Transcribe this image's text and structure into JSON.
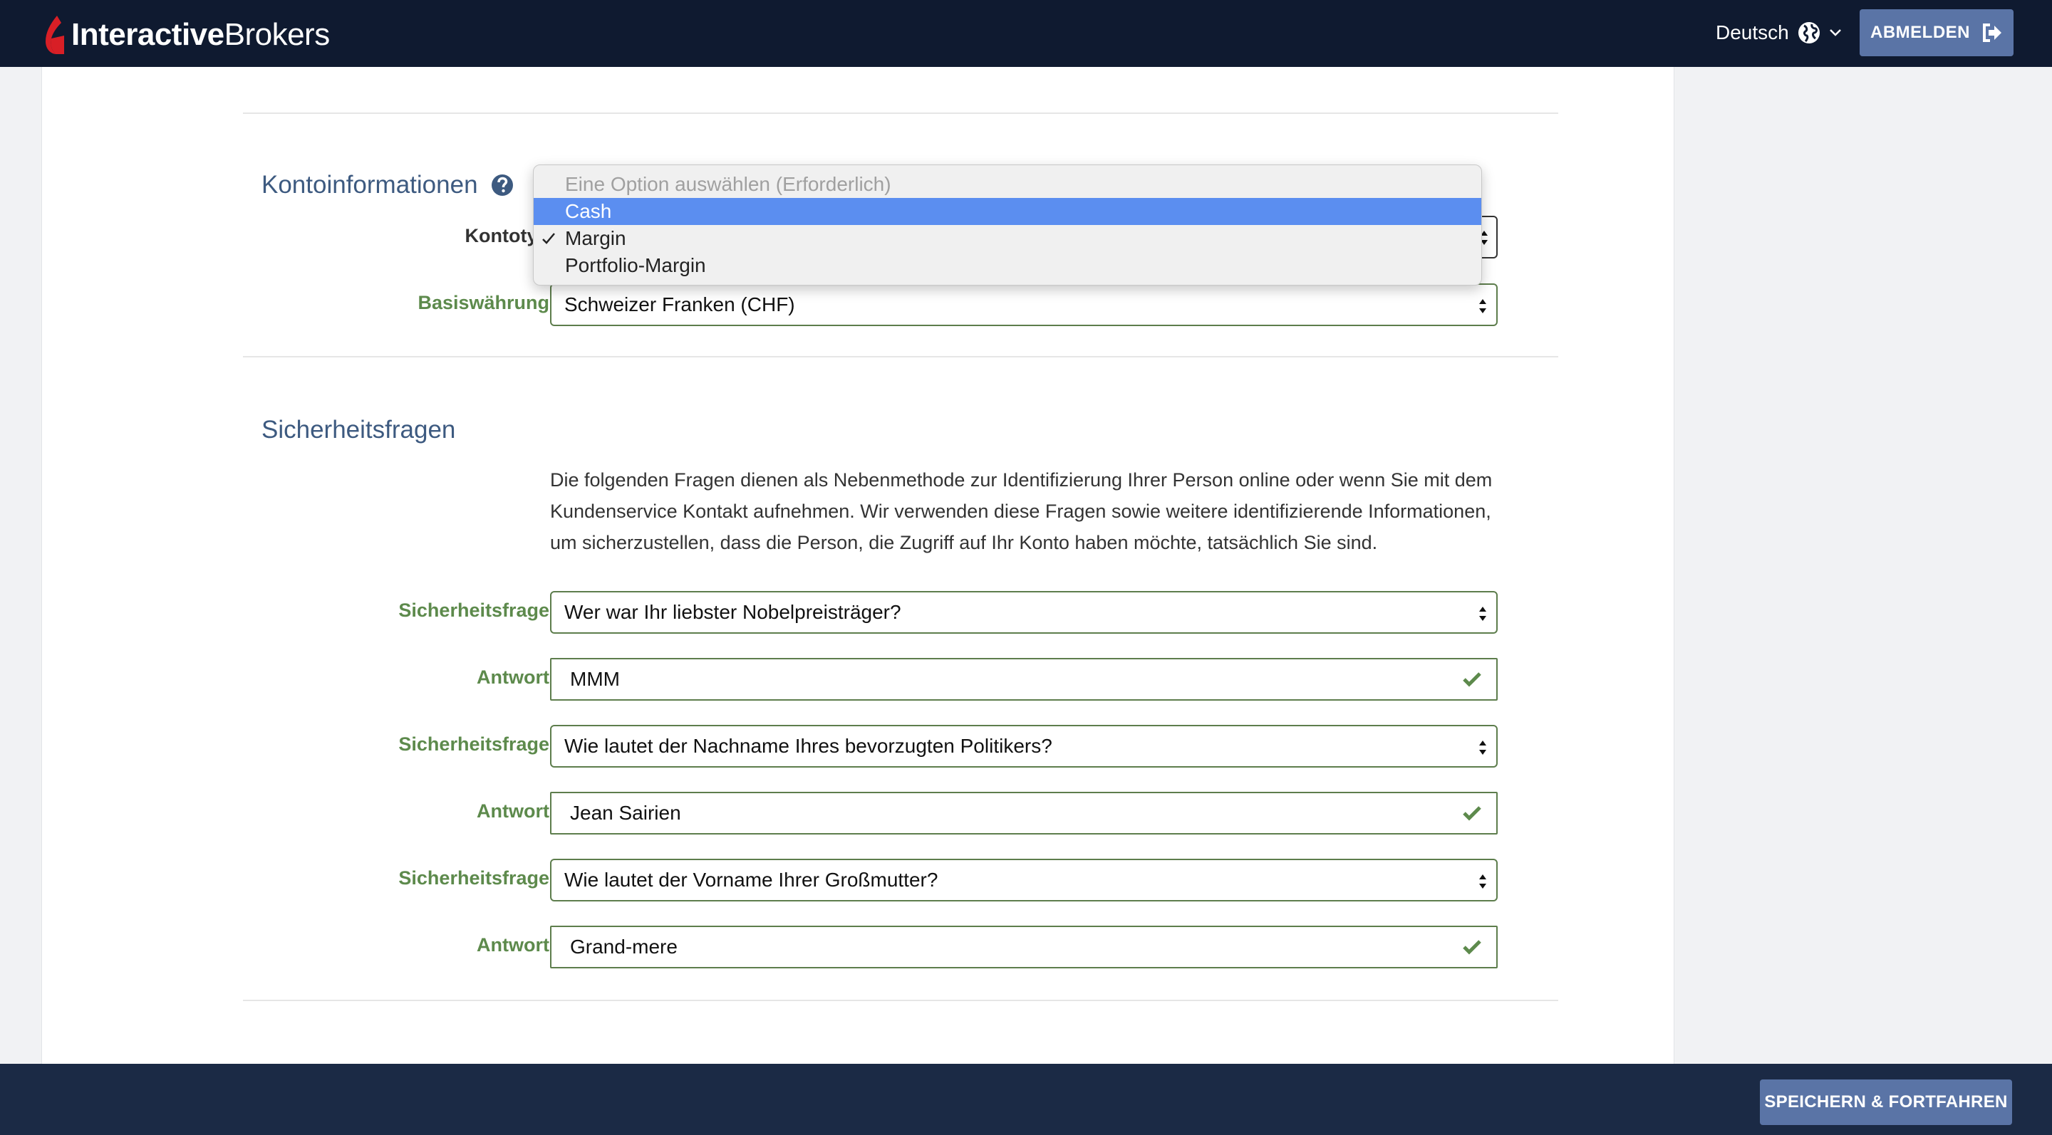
{
  "header": {
    "logo_bold": "Interactive",
    "logo_light": "Brokers",
    "language": "Deutsch",
    "logout_label": "ABMELDEN"
  },
  "account_info": {
    "title": "Kontoinformationen",
    "account_type_label": "Kontotyp",
    "account_type_options": [
      "Eine Option auswählen (Erforderlich)",
      "Cash",
      "Margin",
      "Portfolio-Margin"
    ],
    "account_type_selected": "Margin",
    "account_type_highlighted": "Cash",
    "base_currency_label": "Basiswährung",
    "base_currency_value": "Schweizer Franken (CHF)"
  },
  "security": {
    "title": "Sicherheitsfragen",
    "description": "Die folgenden Fragen dienen als Nebenmethode zur Identifizierung Ihrer Person online oder wenn Sie mit dem Kundenservice Kontakt aufnehmen. Wir verwenden diese Fragen sowie weitere identifizierende Informationen, um sicherzustellen, dass die Person, die Zugriff auf Ihr Konto haben möchte, tatsächlich Sie sind.",
    "question_label": "Sicherheitsfrage",
    "answer_label": "Antwort",
    "items": [
      {
        "question": "Wer war Ihr liebster Nobelpreisträger?",
        "answer": "MMM"
      },
      {
        "question": "Wie lautet der Nachname Ihres bevorzugten Politikers?",
        "answer": "Jean Sairien"
      },
      {
        "question": "Wie lautet der Vorname Ihrer Großmutter?",
        "answer": "Grand-mere"
      }
    ]
  },
  "footer": {
    "save_label": "SPEICHERN & FORTFAHREN"
  },
  "colors": {
    "nav_bg": "#0f1a30",
    "footer_bg": "#1b2a45",
    "button_bg": "#5a74a6",
    "label_green": "#5d8a4c",
    "title_blue": "#3d5a80",
    "highlight_blue": "#5b8ef0"
  },
  "icons": [
    "ib-logo-mark",
    "globe-icon",
    "chevron-down-icon",
    "logout-icon",
    "help-icon",
    "select-arrows-icon",
    "checkmark-icon"
  ]
}
